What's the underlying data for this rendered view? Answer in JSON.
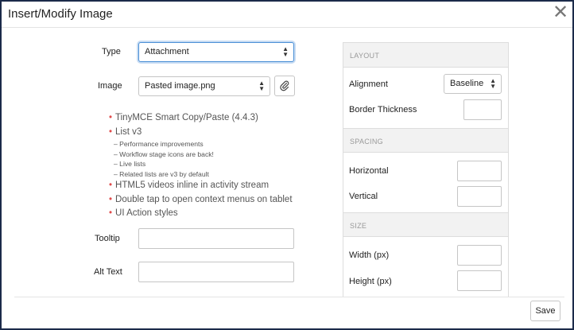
{
  "dialog": {
    "title": "Insert/Modify Image",
    "close_glyph": "✕"
  },
  "form": {
    "type": {
      "label": "Type",
      "value": "Attachment"
    },
    "image": {
      "label": "Image",
      "value": "Pasted image.png",
      "attach_icon": "paperclip-icon"
    },
    "tooltip": {
      "label": "Tooltip",
      "value": ""
    },
    "alt_text": {
      "label": "Alt Text",
      "value": ""
    }
  },
  "release_notes": {
    "items": [
      {
        "text": "TinyMCE Smart Copy/Paste (4.4.3)",
        "subitems": []
      },
      {
        "text": "List v3",
        "subitems": [
          "– Performance improvements",
          "– Workflow stage icons are back!",
          "– Live lists",
          "– Related lists are v3 by default"
        ]
      },
      {
        "text": "HTML5 videos inline in activity stream",
        "subitems": []
      },
      {
        "text": "Double tap to open context menus on tablet",
        "subitems": []
      },
      {
        "text": "UI Action styles",
        "subitems": []
      }
    ]
  },
  "panel": {
    "layout": {
      "header": "LAYOUT",
      "alignment_label": "Alignment",
      "alignment_value": "Baseline",
      "border_label": "Border Thickness",
      "border_value": ""
    },
    "spacing": {
      "header": "SPACING",
      "horizontal_label": "Horizontal",
      "horizontal_value": "",
      "vertical_label": "Vertical",
      "vertical_value": ""
    },
    "size": {
      "header": "SIZE",
      "width_label": "Width (px)",
      "width_value": "",
      "height_label": "Height (px)",
      "height_value": ""
    }
  },
  "footer": {
    "save_label": "Save"
  },
  "colors": {
    "bullet": "#e04b4b",
    "focus_border": "#4a8fd6",
    "dialog_border": "#1b2a4a"
  }
}
